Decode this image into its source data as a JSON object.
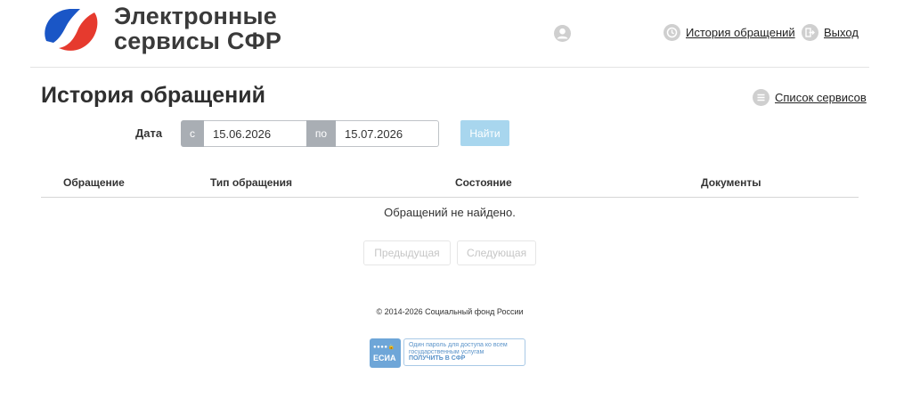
{
  "header": {
    "brand_line1": "Электронные",
    "brand_line2": "сервисы СФР",
    "history_link": "История обращений",
    "logout_link": "Выход",
    "brand_colors": {
      "blue": "#1a56c6",
      "red": "#e63a2e"
    }
  },
  "page": {
    "title": "История обращений",
    "services_link": "Список сервисов"
  },
  "filter": {
    "date_label": "Дата",
    "from_prefix": "с",
    "from_value": "15.06.2026",
    "to_prefix": "по",
    "to_value": "15.07.2026",
    "search_button": "Найти"
  },
  "table": {
    "columns": [
      "Обращение",
      "Тип обращения",
      "Состояние",
      "Документы"
    ],
    "empty_message": "Обращений не найдено."
  },
  "pagination": {
    "prev": "Предыдущая",
    "next": "Следующая"
  },
  "footer": {
    "copyright": "© 2014-2026 Социальный фонд России",
    "esia_label": "ЕСИА",
    "esia_line1": "Один пароль для доступа ко всем",
    "esia_line2": "государственным услугам",
    "esia_line3": "ПОЛУЧИТЬ В СФР"
  },
  "icons": {
    "user": "user-icon",
    "history": "history-icon",
    "logout": "logout-icon",
    "list": "list-icon",
    "lock": "lock-icon"
  }
}
